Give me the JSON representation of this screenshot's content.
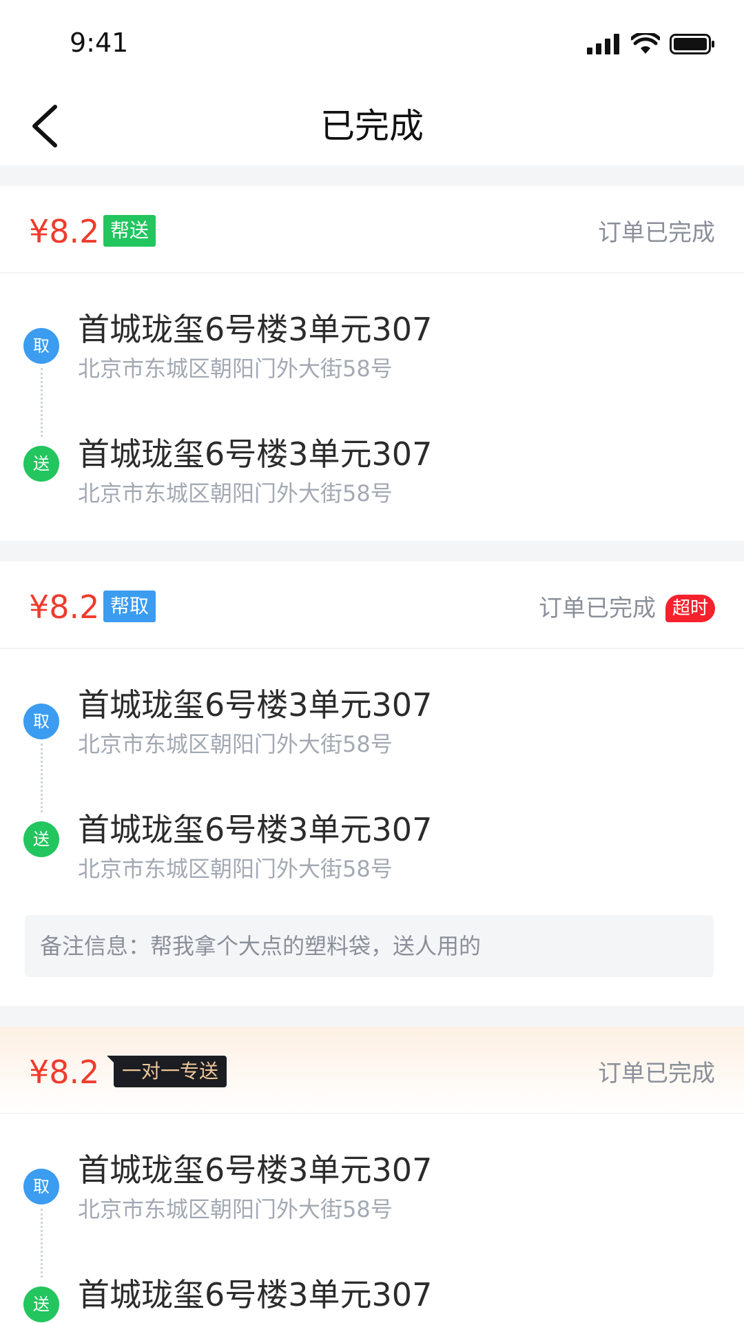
{
  "status_bar": {
    "time": "9:41"
  },
  "nav": {
    "title": "已完成"
  },
  "orders": [
    {
      "price": "¥8.2",
      "tag": "帮送",
      "status": "订单已完成",
      "pickup": {
        "badge": "取",
        "title": "首城珑玺6号楼3单元307",
        "address": "北京市东城区朝阳门外大街58号"
      },
      "dropoff": {
        "badge": "送",
        "title": "首城珑玺6号楼3单元307",
        "address": "北京市东城区朝阳门外大街58号"
      }
    },
    {
      "price": "¥8.2",
      "tag": "帮取",
      "status": "订单已完成",
      "overtime_badge": "超时",
      "pickup": {
        "badge": "取",
        "title": "首城珑玺6号楼3单元307",
        "address": "北京市东城区朝阳门外大街58号"
      },
      "dropoff": {
        "badge": "送",
        "title": "首城珑玺6号楼3单元307",
        "address": "北京市东城区朝阳门外大街58号"
      },
      "remark": "备注信息：帮我拿个大点的塑料袋，送人用的"
    },
    {
      "price": "¥8.2",
      "tag": "一对一专送",
      "status": "订单已完成",
      "pickup": {
        "badge": "取",
        "title": "首城珑玺6号楼3单元307",
        "address": "北京市东城区朝阳门外大街58号"
      },
      "dropoff": {
        "badge": "送",
        "title": "首城珑玺6号楼3单元307"
      }
    }
  ],
  "colors": {
    "price": "#ef3b2c",
    "tag_green": "#22c55e",
    "tag_blue": "#3b9cf0",
    "overtime_red": "#f5222d",
    "special_tag_bg": "#1b1d22"
  },
  "icons": [
    "back-arrow-icon",
    "signal-icon",
    "wifi-icon",
    "battery-icon"
  ]
}
